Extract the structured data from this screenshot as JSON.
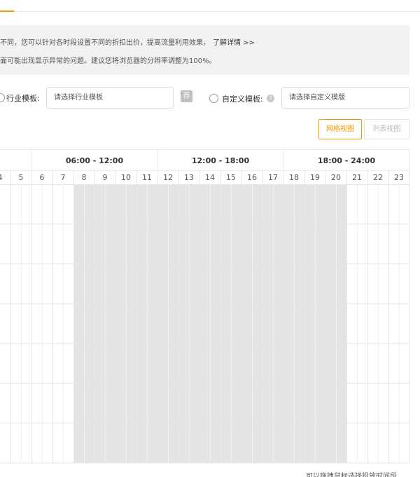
{
  "notice": {
    "line1": "不同，您可以针对各时段设置不同的折扣出价，提高流量利用效果，",
    "learn_more": "了解详情 >>",
    "line2": "面可能出现显示异常的问题。建议您将浏览器的分辨率调整为100%。"
  },
  "template": {
    "industry_label": "行业模板:",
    "industry_placeholder": "请选择行业模板",
    "recommend_badge": "荐",
    "custom_label": "自定义模板:",
    "custom_placeholder": "请选择自定义模版"
  },
  "view": {
    "grid_label": "网格视图",
    "list_label": "列表视图",
    "active": "grid"
  },
  "schedule": {
    "hour_columns": [
      "4",
      "5",
      "6",
      "7",
      "8",
      "9",
      "10",
      "11",
      "12",
      "13",
      "14",
      "15",
      "16",
      "17",
      "18",
      "19",
      "20",
      "21",
      "22",
      "23"
    ],
    "period_headers": [
      {
        "label": "",
        "from_hour": 4,
        "to_hour": 5
      },
      {
        "label": "06:00 - 12:00",
        "from_hour": 6,
        "to_hour": 11
      },
      {
        "label": "12:00 - 18:00",
        "from_hour": 12,
        "to_hour": 17
      },
      {
        "label": "18:00 - 24:00",
        "from_hour": 18,
        "to_hour": 23
      }
    ],
    "row_count": 7,
    "selected_hours": [
      8,
      9,
      10,
      11,
      12,
      13,
      14,
      15,
      16,
      17,
      18,
      19,
      20
    ],
    "selected_color": "#e4e4e4",
    "border_color": "#e8e8e8"
  },
  "footer": {
    "hint": "可以拖拽鼠标选择投放时间段"
  },
  "colors": {
    "accent": "#f39800",
    "notice_bg": "#f2f2f2"
  }
}
